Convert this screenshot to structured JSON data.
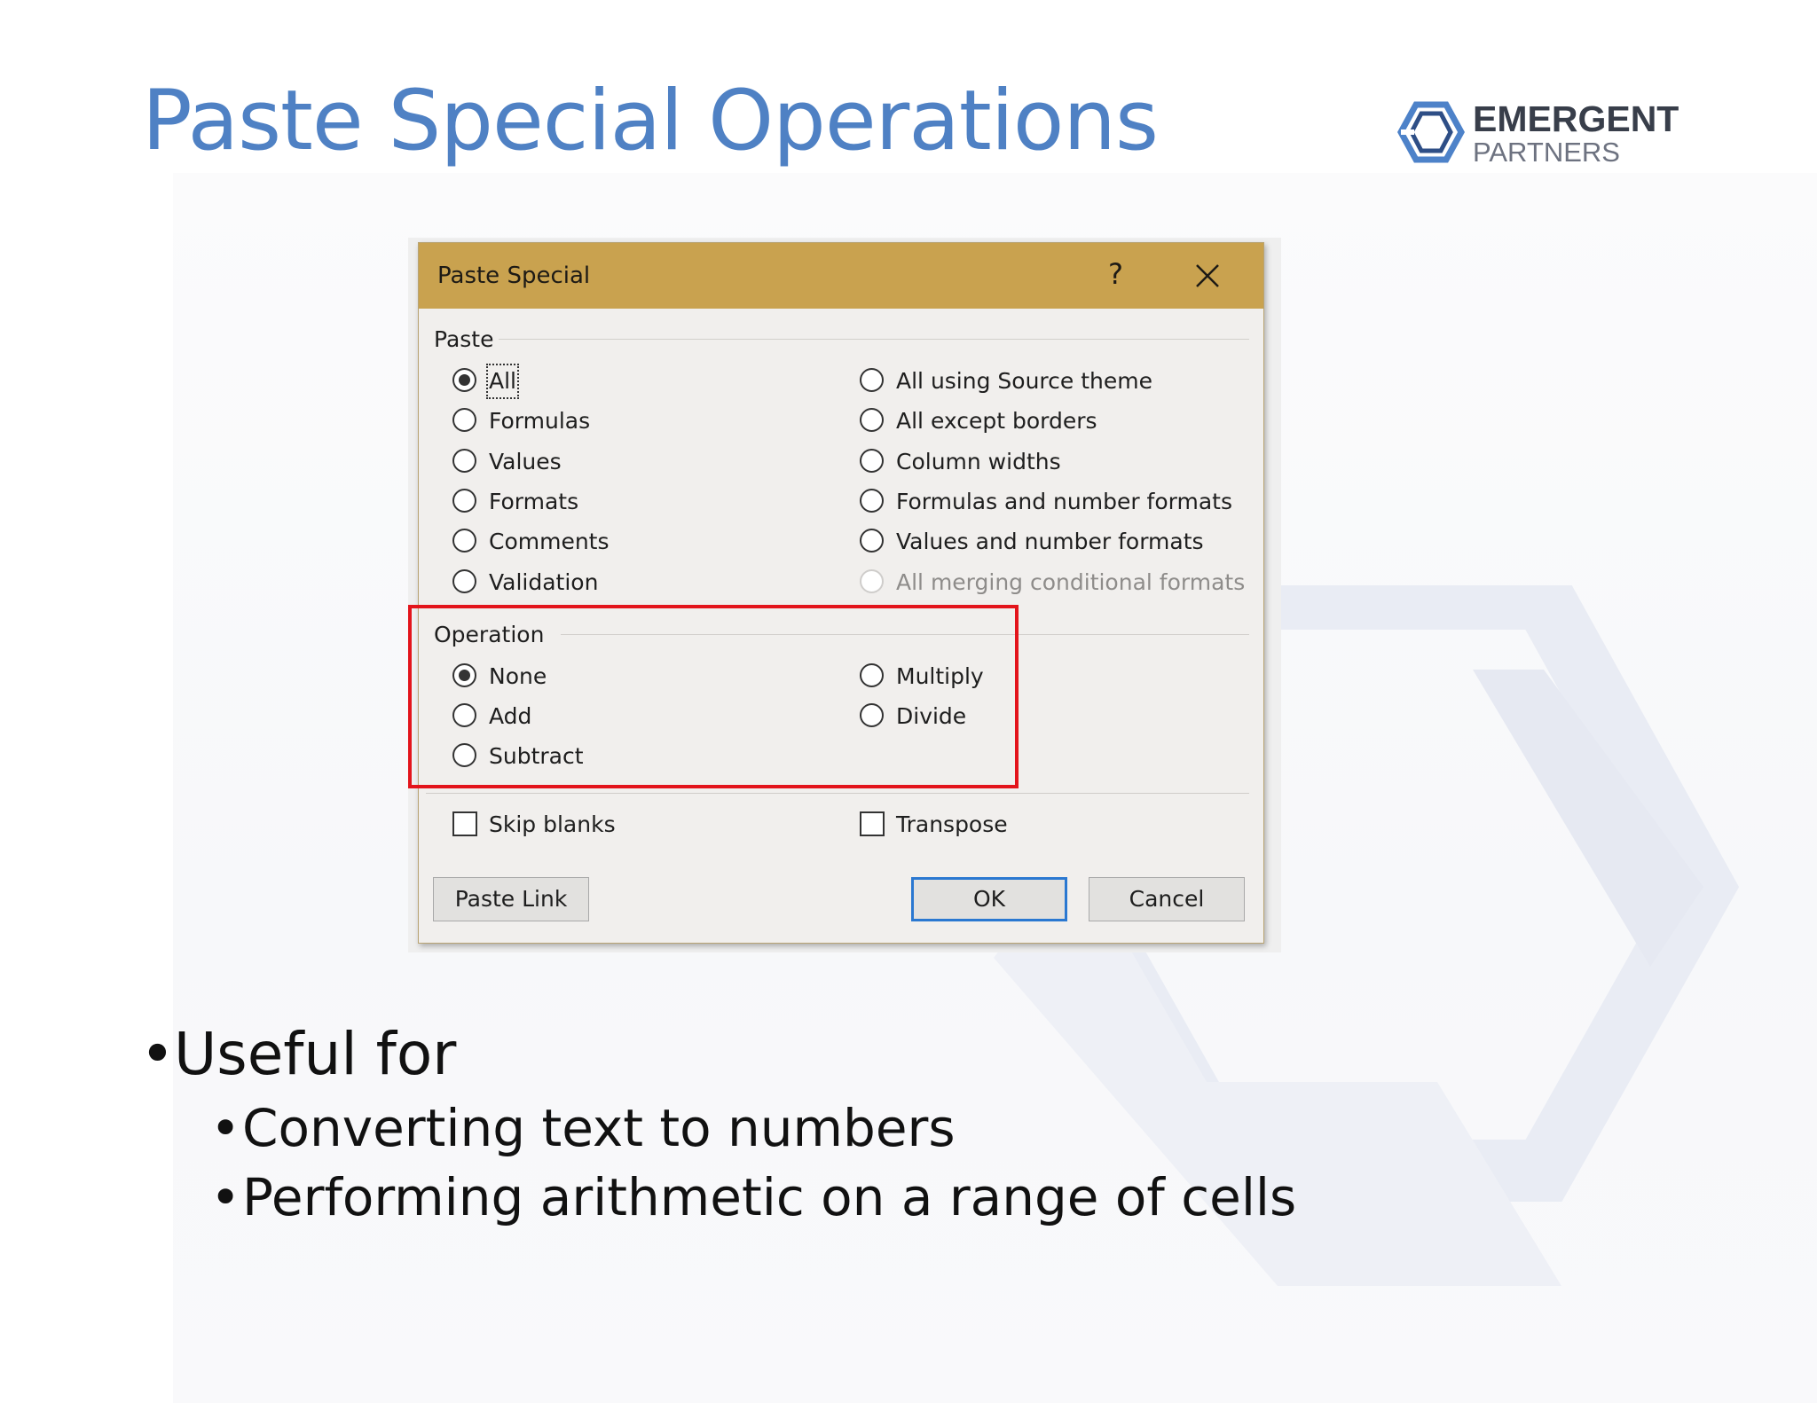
{
  "slide": {
    "title": "Paste Special Operations",
    "logo": {
      "line1": "EMERGENT",
      "line2": "PARTNERS"
    },
    "bullets": {
      "main": "Useful for",
      "sub": [
        "Converting text to numbers",
        "Performing arithmetic on a range of cells"
      ]
    }
  },
  "dialog": {
    "title": "Paste Special",
    "help_label": "?",
    "paste_group_label": "Paste",
    "paste_options_left": [
      "All",
      "Formulas",
      "Values",
      "Formats",
      "Comments",
      "Validation"
    ],
    "paste_options_right": [
      "All using Source theme",
      "All except borders",
      "Column widths",
      "Formulas and number formats",
      "Values and number formats",
      "All merging conditional formats"
    ],
    "paste_selected": "All",
    "paste_disabled": "All merging conditional formats",
    "operation_group_label": "Operation",
    "operation_options_left": [
      "None",
      "Add",
      "Subtract"
    ],
    "operation_options_right": [
      "Multiply",
      "Divide"
    ],
    "operation_selected": "None",
    "skip_blanks_label": "Skip blanks",
    "transpose_label": "Transpose",
    "paste_link_label": "Paste Link",
    "ok_label": "OK",
    "cancel_label": "Cancel"
  },
  "colors": {
    "title_blue": "#4f81c4",
    "titlebar_gold": "#c9a24f",
    "highlight_red": "#e3141b",
    "default_button_blue": "#2a78d1"
  },
  "icons": [
    "close-icon",
    "emergent-partners-logo-icon",
    "background-hexagon-watermark"
  ]
}
